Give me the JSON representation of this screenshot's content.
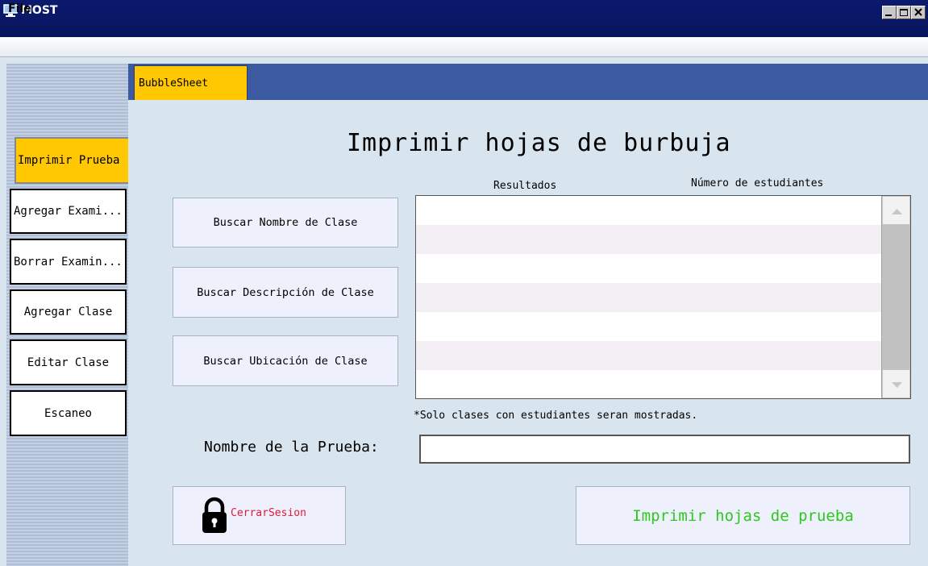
{
  "window": {
    "title": "MOST"
  },
  "menubar": {
    "items": [
      "File"
    ]
  },
  "sidebar": {
    "items": [
      {
        "label": "Imprimir Prueba",
        "active": true
      },
      {
        "label": "Agregar Exami..."
      },
      {
        "label": "Borrar Examin..."
      },
      {
        "label": "Agregar Clase"
      },
      {
        "label": "Editar Clase"
      },
      {
        "label": "Escaneo"
      }
    ]
  },
  "tabs": [
    {
      "label": "BubbleSheet",
      "active": true
    }
  ],
  "main": {
    "title": "Imprimir hojas de burbuja",
    "search_buttons": [
      "Buscar Nombre de Clase",
      "Buscar Descripción de Clase",
      "Buscar Ubicación de Clase"
    ],
    "results_table": {
      "columns": [
        "Resultados",
        "Número de estudiantes"
      ],
      "rows": []
    },
    "note": "*Solo clases con estudiantes seran mostradas.",
    "test_name_label": "Nombre de la Prueba:",
    "test_name_value": "",
    "logout_label": "CerrarSesion",
    "print_label": "Imprimir hojas de prueba"
  },
  "colors": {
    "accent": "#ffc802",
    "tab_strip": "#3c5aa0",
    "title_bar": "#0c1a6e",
    "logout_text": "#e01b3a",
    "print_text": "#2ec81e",
    "background": "#d9e5ee"
  }
}
